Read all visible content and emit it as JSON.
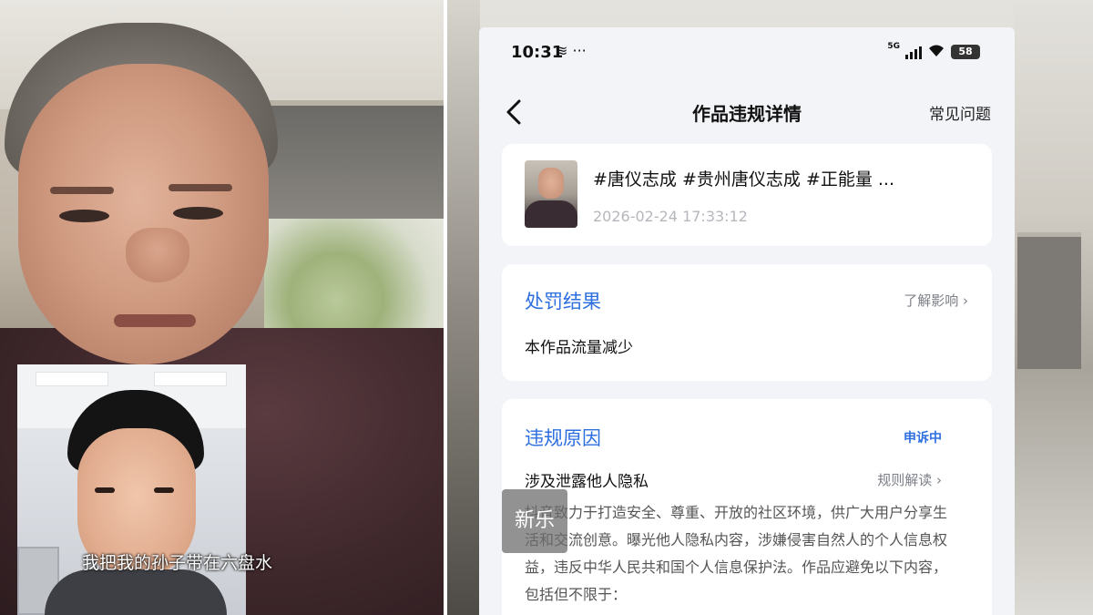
{
  "video_call": {
    "subtitle": "我把我的孙子带在六盘水"
  },
  "phone": {
    "status_bar": {
      "time": "10:31",
      "indicators": "≋ ···",
      "network": "5G",
      "battery": "58"
    },
    "nav": {
      "title": "作品违规详情",
      "faq_label": "常见问题"
    },
    "work": {
      "title": "#唐仪志成 #贵州唐仪志成 #正能量 ...",
      "timestamp": "2026-02-24 17:33:12"
    },
    "penalty": {
      "title": "处罚结果",
      "learn_label": "了解影响 ›",
      "result": "本作品流量减少"
    },
    "reason": {
      "title": "违规原因",
      "status": "申诉中",
      "name": "涉及泄露他人隐私",
      "rules_label": "规则解读 ›",
      "description": "抖音致力于打造安全、尊重、开放的社区环境，供广大用户分享生活和交流创意。曝光他人隐私内容，涉嫌侵害自然人的个人信息权益，违反中华人民共和国个人信息保护法。作品应避免以下内容，包括但不限于："
    }
  },
  "watermark": "新乐",
  "colors": {
    "accent_blue": "#2e6fe0",
    "background": "#f3f4f8",
    "muted_text": "#7c7f87"
  }
}
